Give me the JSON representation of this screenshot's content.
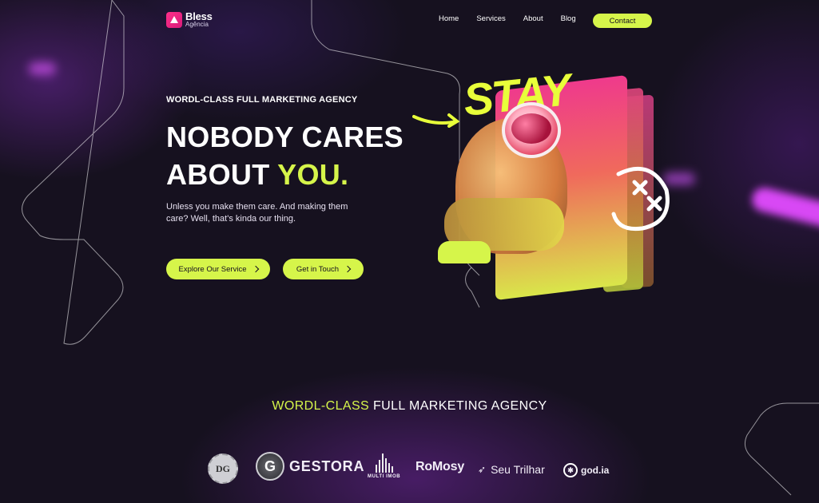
{
  "brand": {
    "name": "Bless",
    "sub": "Agência"
  },
  "nav": {
    "items": [
      "Home",
      "Services",
      "About",
      "Blog"
    ],
    "contact": "Contact"
  },
  "hero": {
    "eyebrow": "WORDL-CLASS FULL MARKETING AGENCY",
    "title_line1": "NOBODY CARES",
    "title_line2_a": "ABOUT ",
    "title_line2_b": "YOU.",
    "description": "Unless you make them care. And making them care? Well, that's kinda our thing.",
    "cta_primary": "Explore Our Service",
    "cta_secondary": "Get in Touch",
    "graffiti": "STAY"
  },
  "partners": {
    "title_highlight": "WORDL-CLASS",
    "title_rest": " FULL MARKETING AGENCY",
    "logos": {
      "dg": "DG",
      "gestora_mark": "G",
      "gestora": "GESTORA",
      "multi": "MULTI IMOB",
      "romosy": "RoMosy",
      "seu": "Seu Trilhar",
      "god": "god.ia"
    }
  },
  "colors": {
    "accent": "#d6f54a",
    "brand": "#e91e7c",
    "background": "#16111f"
  }
}
